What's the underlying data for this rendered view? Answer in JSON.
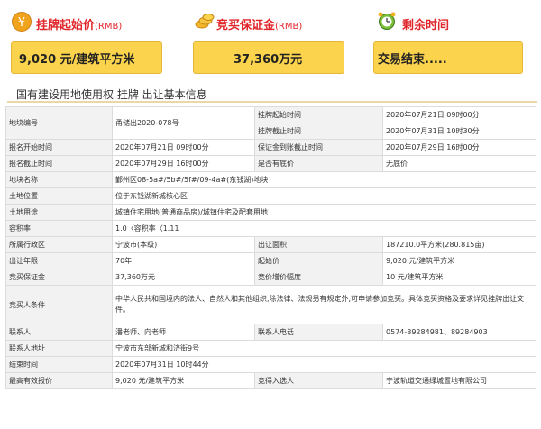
{
  "header": {
    "start_price": {
      "title": "挂牌起始价",
      "unit": "(RMB)",
      "value": "9,020 元/建筑平方米",
      "icon": "yen-coin-icon"
    },
    "deposit": {
      "title": "竞买保证金",
      "unit": "(RMB)",
      "value": "37,360万元",
      "icon": "coins-icon"
    },
    "remaining": {
      "title": "剩余时间",
      "value": "交易结束.....",
      "icon": "alarm-clock-icon"
    }
  },
  "section_title": "国有建设用地使用权 挂牌 出让基本信息",
  "colors": {
    "accent": "#e0262a",
    "box": "#fbd34c",
    "label_bg": "#f2f2f2"
  },
  "info": {
    "r1": {
      "l1": "地块编号",
      "v1": "甬储出2020-078号",
      "l2a": "挂牌起始时间",
      "v2a": "2020年07月21日 09时00分",
      "l2b": "挂牌截止时间",
      "v2b": "2020年07月31日 10时30分"
    },
    "r2": {
      "l1": "报名开始时间",
      "v1": "2020年07月21日 09时00分",
      "l2": "保证金到账截止时间",
      "v2": "2020年07月29日 16时00分"
    },
    "r3": {
      "l1": "报名截止时间",
      "v1": "2020年07月29日 16时00分",
      "l2": "是否有底价",
      "v2": "无底价"
    },
    "r4": {
      "l": "地块名称",
      "v": "鄞州区08-5a#/5b#/5f#/09-4a#(东钱湖)地块"
    },
    "r5": {
      "l": "土地位置",
      "v": "位于东钱湖新城核心区"
    },
    "r6": {
      "l": "土地用途",
      "v": "城镇住宅用地(普通商品房)/城镇住宅及配套用地"
    },
    "r7": {
      "l": "容积率",
      "v": "1.0〈容积率〈1.11"
    },
    "r8": {
      "l1": "所属行政区",
      "v1": "宁波市(本级)",
      "l2": "出让面积",
      "v2": "187210.0平方米(280.815亩)"
    },
    "r9": {
      "l1": "出让年限",
      "v1": "70年",
      "l2": "起始价",
      "v2": "9,020 元/建筑平方米"
    },
    "r10": {
      "l1": "竞买保证金",
      "v1": "37,360万元",
      "l2": "竞价增价幅度",
      "v2": "10 元/建筑平方米"
    },
    "r11": {
      "l": "竞买人条件",
      "v": "中华人民共和国境内的法人、自然人和其他组织,除法律、法规另有规定外,可申请参加竞买。具体竞买资格及要求详见挂牌出让文件。"
    },
    "r12": {
      "l1": "联系人",
      "v1": "潘老师、向老师",
      "l2": "联系人电话",
      "v2": "0574-89284981、89284903"
    },
    "r13": {
      "l": "联系人地址",
      "v": "宁波市东部新城和济街9号"
    },
    "r14": {
      "l": "结束时间",
      "v": "2020年07月31日 10时44分"
    },
    "r15": {
      "l1": "最高有效报价",
      "v1": "9,020 元/建筑平方米",
      "l2": "竞得入选人",
      "v2": "宁波轨道交通绿城置地有限公司"
    }
  }
}
